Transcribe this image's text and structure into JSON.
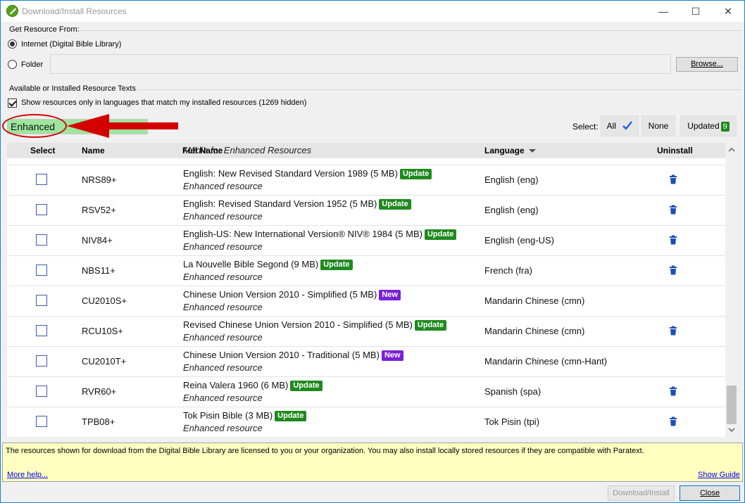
{
  "window": {
    "title": "Download/Install Resources",
    "controls": {
      "minimize": "—",
      "maximize": "☐",
      "close": "✕"
    }
  },
  "source": {
    "group_label": "Get Resource From:",
    "internet_label": "Internet (Digital Bible Library)",
    "folder_label": "Folder",
    "folder_value": "",
    "browse_label": "Browse..."
  },
  "resources": {
    "group_label": "Available or Installed Resource Texts",
    "filter_checkbox_label": "Show resources only in languages that match my installed resources (1269 hidden)",
    "filter_checkbox_checked": true,
    "filter_value": "Enhanced",
    "select_label": "Select:",
    "select_all_label": "All",
    "select_none_label": "None",
    "select_updated_label": "Updated",
    "updated_count": "9"
  },
  "table": {
    "columns": [
      "Select",
      "Name",
      "Full Name",
      "Language",
      "Uninstall"
    ],
    "partial_row_text": "Media for Enhanced Resources",
    "rows": [
      {
        "name": "NRS89+",
        "full_name": "English: New Revised Standard Version 1989 (5 MB)",
        "badge": "Update",
        "sub": "Enhanced resource",
        "language": "English (eng)",
        "uninstall": true
      },
      {
        "name": "RSV52+",
        "full_name": "English: Revised Standard Version 1952 (5 MB)",
        "badge": "Update",
        "sub": "Enhanced resource",
        "language": "English (eng)",
        "uninstall": true
      },
      {
        "name": "NIV84+",
        "full_name": "English-US: New International Version® NIV® 1984 (5 MB)",
        "badge": "Update",
        "sub": "Enhanced resource",
        "language": "English (eng-US)",
        "uninstall": true
      },
      {
        "name": "NBS11+",
        "full_name": "La Nouvelle Bible Segond (9 MB)",
        "badge": "Update",
        "sub": "Enhanced resource",
        "language": "French (fra)",
        "uninstall": true
      },
      {
        "name": "CU2010S+",
        "full_name": "Chinese Union Version 2010 - Simplified (5 MB)",
        "badge": "New",
        "sub": "Enhanced resource",
        "language": "Mandarin Chinese (cmn)",
        "uninstall": false
      },
      {
        "name": "RCU10S+",
        "full_name": "Revised Chinese Union Version 2010 - Simplified (5 MB)",
        "badge": "Update",
        "sub": "Enhanced resource",
        "language": "Mandarin Chinese (cmn)",
        "uninstall": true
      },
      {
        "name": "CU2010T+",
        "full_name": "Chinese Union Version 2010 - Traditional (5 MB)",
        "badge": "New",
        "sub": "Enhanced resource",
        "language": "Mandarin Chinese (cmn-Hant)",
        "uninstall": false
      },
      {
        "name": "RVR60+",
        "full_name": "Reina Valera 1960 (6 MB)",
        "badge": "Update",
        "sub": "Enhanced resource",
        "language": "Spanish (spa)",
        "uninstall": true
      },
      {
        "name": "TPB08+",
        "full_name": "Tok Pisin Bible (3 MB)",
        "badge": "Update",
        "sub": "Enhanced resource",
        "language": "Tok Pisin (tpi)",
        "uninstall": true
      }
    ]
  },
  "license": {
    "text": "The resources shown for download from the Digital Bible Library are licensed to you or your organization. You may also install locally stored resources if they are compatible with Paratext.",
    "more_help": "More help...",
    "show_guide": "Show Guide"
  },
  "footer": {
    "download_label": "Download/Install",
    "close_label": "Close"
  },
  "colors": {
    "update_badge": "#1e8a1e",
    "new_badge": "#7b1fd8",
    "filter_bg": "#9ee59e",
    "annotation": "#d40000",
    "license_bg": "#ffffc0"
  }
}
